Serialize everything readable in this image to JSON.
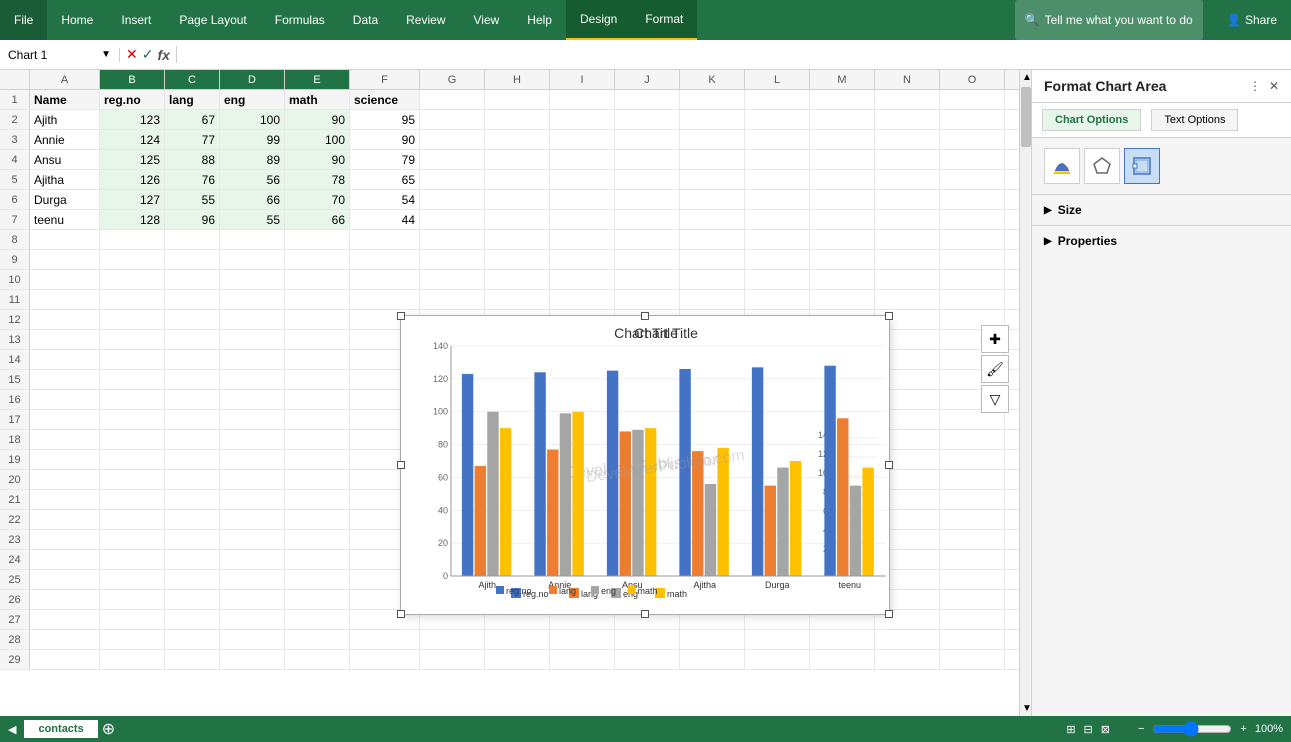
{
  "ribbon": {
    "tabs": [
      "File",
      "Home",
      "Insert",
      "Page Layout",
      "Formulas",
      "Data",
      "Review",
      "View",
      "Help",
      "Design",
      "Format"
    ],
    "search_placeholder": "Tell me what you want to do",
    "share_label": "Share"
  },
  "formula_bar": {
    "name_box": "Chart 1",
    "formula_value": ""
  },
  "columns": [
    "A",
    "B",
    "C",
    "D",
    "E",
    "F",
    "G",
    "H",
    "I",
    "J",
    "K",
    "L",
    "M",
    "N",
    "O"
  ],
  "col_headers": {
    "A": "Name",
    "B": "reg.no",
    "C": "lang",
    "D": "eng",
    "E": "math",
    "F": "science"
  },
  "rows": [
    {
      "num": 1,
      "A": "Name",
      "B": "reg.no",
      "C": "lang",
      "D": "eng",
      "E": "math",
      "F": "science"
    },
    {
      "num": 2,
      "A": "Ajith",
      "B": "123",
      "C": "67",
      "D": "100",
      "E": "90",
      "F": "95"
    },
    {
      "num": 3,
      "A": "Annie",
      "B": "124",
      "C": "77",
      "D": "99",
      "E": "100",
      "F": "90"
    },
    {
      "num": 4,
      "A": "Ansu",
      "B": "125",
      "C": "88",
      "D": "89",
      "E": "90",
      "F": "79"
    },
    {
      "num": 5,
      "A": "Ajitha",
      "B": "126",
      "C": "76",
      "D": "56",
      "E": "78",
      "F": "65"
    },
    {
      "num": 6,
      "A": "Durga",
      "B": "127",
      "C": "55",
      "D": "66",
      "E": "70",
      "F": "54"
    },
    {
      "num": 7,
      "A": "teenu",
      "B": "128",
      "C": "96",
      "D": "55",
      "E": "66",
      "F": "44"
    }
  ],
  "chart": {
    "title": "Chart Title",
    "watermark": "DeveloperPublish.com",
    "categories": [
      "Ajith",
      "Annie",
      "Ansu",
      "Ajitha",
      "Durga",
      "teenu"
    ],
    "series": [
      {
        "name": "reg.no",
        "color": "#4472C4",
        "values": [
          123,
          124,
          125,
          126,
          127,
          128
        ]
      },
      {
        "name": "lang",
        "color": "#ED7D31",
        "values": [
          67,
          77,
          88,
          76,
          55,
          96
        ]
      },
      {
        "name": "eng",
        "color": "#A5A5A5",
        "values": [
          100,
          99,
          89,
          56,
          66,
          55
        ]
      },
      {
        "name": "math",
        "color": "#FFC000",
        "values": [
          90,
          100,
          90,
          78,
          70,
          66
        ]
      }
    ],
    "y_max": 140,
    "y_step": 20
  },
  "panel": {
    "title": "Format Chart Area",
    "tab_chart": "Chart Options",
    "tab_text": "Text Options",
    "sections": [
      "Size",
      "Properties"
    ]
  },
  "sheet": {
    "tab_name": "contacts"
  },
  "status_bar": {
    "zoom": "100%"
  }
}
